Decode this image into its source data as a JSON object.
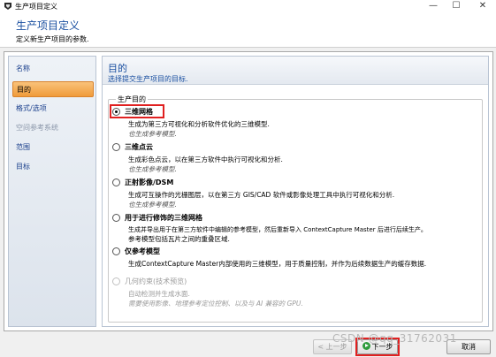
{
  "window": {
    "title": "生产项目定义",
    "controls": [
      "—",
      "☐",
      "✕"
    ]
  },
  "header": {
    "title": "生产项目定义",
    "subtitle": "定义新生产项目的参数."
  },
  "sidebar": {
    "items": [
      {
        "label": "名称",
        "state": "normal"
      },
      {
        "label": "目的",
        "state": "active"
      },
      {
        "label": "格式/选项",
        "state": "normal"
      },
      {
        "label": "空间参考系统",
        "state": "disabled"
      },
      {
        "label": "范围",
        "state": "normal"
      },
      {
        "label": "目标",
        "state": "normal"
      }
    ]
  },
  "content": {
    "title": "目的",
    "subtitle": "选择提交生产项目的目标.",
    "group_label": "生产目的",
    "options": [
      {
        "label": "三维网格",
        "desc": "生成为第三方可视化和分析软件优化的三维模型.",
        "note": "也生成参考模型.",
        "checked": true
      },
      {
        "label": "三维点云",
        "desc": "生成彩色点云，以在第三方软件中执行可视化和分析.",
        "note": "也生成参考模型.",
        "checked": false
      },
      {
        "label": "正射影像/DSM",
        "desc": "生成可互操作的光栅图层，以在第三方 GIS/CAD 软件或影像处理工具中执行可视化和分析.",
        "note": "也生成参考模型.",
        "checked": false
      },
      {
        "label": "用于进行修饰的三维网格",
        "desc": "生成并导出用于在第三方软件中编辑的参考模型，然后重新导入 ContextCapture Master 后进行后续生产。",
        "desc2": "参考模型包括瓦片之间的重叠区域.",
        "checked": false
      },
      {
        "label": "仅参考模型",
        "desc": "生成ContextCapture Master内部使用的三维模型，用于质量控制，并作为后续数据生产的缓存数据.",
        "checked": false
      },
      {
        "label": "几何约束(技术预览)",
        "desc": "自动检测并生成水面.",
        "note": "需要使用影像、地理参考定位控制、以及与 AI 兼容的 GPU.",
        "checked": false,
        "disabled": true
      }
    ]
  },
  "buttons": {
    "back": "< 上一步",
    "next": "下一步",
    "next_prefix": "",
    "cancel": "取消"
  },
  "watermark": "CSDN @qq_31762031"
}
